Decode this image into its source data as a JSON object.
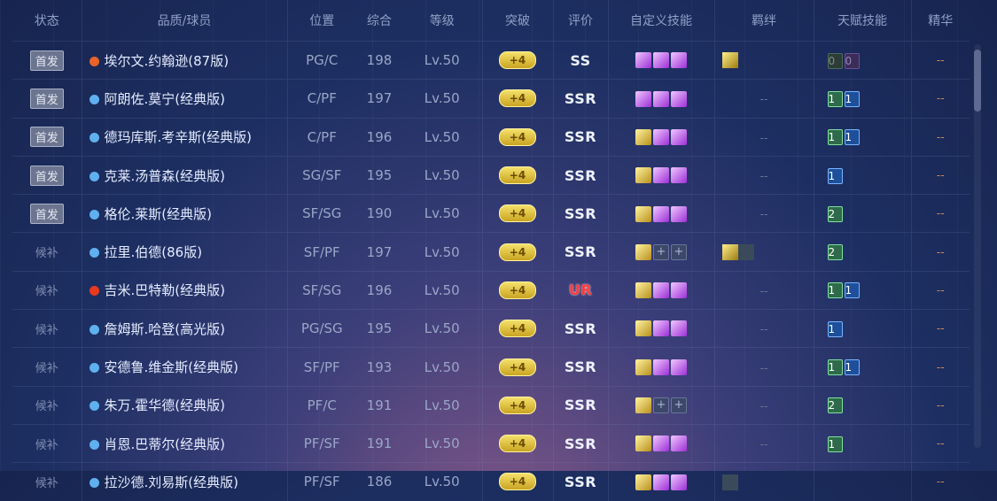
{
  "headers": {
    "status": "状态",
    "player": "品质/球员",
    "position": "位置",
    "overall": "综合",
    "level": "等级",
    "breakthrough": "突破",
    "rating": "评价",
    "custom_skills": "自定义技能",
    "bond": "羁绊",
    "talent": "天赋技能",
    "essence": "精华"
  },
  "rows": [
    {
      "status": "首发",
      "starter": true,
      "dot": "#e8632a",
      "name": "埃尔文.约翰逊(87版)",
      "pos": "PG/C",
      "ovr": "198",
      "lvl": "Lv.50",
      "brk": "+4",
      "rating": "SS",
      "skills": [
        "purple",
        "purple",
        "purple"
      ],
      "bond": [
        "gold"
      ],
      "talents": [
        {
          "v": "0",
          "c": "g0"
        },
        {
          "v": "0",
          "c": "p0"
        }
      ],
      "ess": "--"
    },
    {
      "status": "首发",
      "starter": true,
      "dot": "#5fb0ef",
      "name": "阿朗佐.莫宁(经典版)",
      "pos": "C/PF",
      "ovr": "197",
      "lvl": "Lv.50",
      "brk": "+4",
      "rating": "SSR",
      "skills": [
        "purple",
        "purple",
        "purple"
      ],
      "bond": [],
      "talents": [
        {
          "v": "1",
          "c": "green"
        },
        {
          "v": "1",
          "c": "blue"
        }
      ],
      "ess": "--"
    },
    {
      "status": "首发",
      "starter": true,
      "dot": "#5fb0ef",
      "name": "德玛库斯.考辛斯(经典版)",
      "pos": "C/PF",
      "ovr": "196",
      "lvl": "Lv.50",
      "brk": "+4",
      "rating": "SSR",
      "skills": [
        "gold",
        "purple",
        "purple"
      ],
      "bond": [],
      "talents": [
        {
          "v": "1",
          "c": "green"
        },
        {
          "v": "1",
          "c": "blue"
        }
      ],
      "ess": "--"
    },
    {
      "status": "首发",
      "starter": true,
      "dot": "#5fb0ef",
      "name": "克莱.汤普森(经典版)",
      "pos": "SG/SF",
      "ovr": "195",
      "lvl": "Lv.50",
      "brk": "+4",
      "rating": "SSR",
      "skills": [
        "gold",
        "purple",
        "purple"
      ],
      "bond": [],
      "talents": [
        {
          "v": "1",
          "c": "blue"
        }
      ],
      "ess": "--"
    },
    {
      "status": "首发",
      "starter": true,
      "dot": "#5fb0ef",
      "name": "格伦.莱斯(经典版)",
      "pos": "SF/SG",
      "ovr": "190",
      "lvl": "Lv.50",
      "brk": "+4",
      "rating": "SSR",
      "skills": [
        "gold",
        "purple",
        "purple"
      ],
      "bond": [],
      "talents": [
        {
          "v": "2",
          "c": "green"
        }
      ],
      "ess": "--"
    },
    {
      "status": "候补",
      "starter": false,
      "dot": "#5fb0ef",
      "name": "拉里.伯德(86版)",
      "pos": "SF/PF",
      "ovr": "197",
      "lvl": "Lv.50",
      "brk": "+4",
      "rating": "SSR",
      "skills": [
        "gold",
        "gray",
        "gray"
      ],
      "bond": [
        "gold",
        "dim"
      ],
      "talents": [
        {
          "v": "2",
          "c": "green"
        }
      ],
      "ess": "--"
    },
    {
      "status": "候补",
      "starter": false,
      "dot": "#e8391e",
      "name": "吉米.巴特勒(经典版)",
      "pos": "SF/SG",
      "ovr": "196",
      "lvl": "Lv.50",
      "brk": "+4",
      "rating": "UR",
      "skills": [
        "gold",
        "purple",
        "purple"
      ],
      "bond": [],
      "talents": [
        {
          "v": "1",
          "c": "green"
        },
        {
          "v": "1",
          "c": "blue"
        }
      ],
      "ess": "--"
    },
    {
      "status": "候补",
      "starter": false,
      "dot": "#5fb0ef",
      "name": "詹姆斯.哈登(高光版)",
      "pos": "PG/SG",
      "ovr": "195",
      "lvl": "Lv.50",
      "brk": "+4",
      "rating": "SSR",
      "skills": [
        "gold",
        "purple",
        "purple"
      ],
      "bond": [],
      "talents": [
        {
          "v": "1",
          "c": "blue"
        }
      ],
      "ess": "--"
    },
    {
      "status": "候补",
      "starter": false,
      "dot": "#5fb0ef",
      "name": "安德鲁.维金斯(经典版)",
      "pos": "SF/PF",
      "ovr": "193",
      "lvl": "Lv.50",
      "brk": "+4",
      "rating": "SSR",
      "skills": [
        "gold",
        "purple",
        "purple"
      ],
      "bond": [],
      "talents": [
        {
          "v": "1",
          "c": "green"
        },
        {
          "v": "1",
          "c": "blue"
        }
      ],
      "ess": "--"
    },
    {
      "status": "候补",
      "starter": false,
      "dot": "#5fb0ef",
      "name": "朱万.霍华德(经典版)",
      "pos": "PF/C",
      "ovr": "191",
      "lvl": "Lv.50",
      "brk": "+4",
      "rating": "SSR",
      "skills": [
        "gold",
        "gray",
        "gray"
      ],
      "bond": [],
      "talents": [
        {
          "v": "2",
          "c": "green"
        }
      ],
      "ess": "--"
    },
    {
      "status": "候补",
      "starter": false,
      "dot": "#5fb0ef",
      "name": "肖恩.巴蒂尔(经典版)",
      "pos": "PF/SF",
      "ovr": "191",
      "lvl": "Lv.50",
      "brk": "+4",
      "rating": "SSR",
      "skills": [
        "gold",
        "purple",
        "purple"
      ],
      "bond": [],
      "talents": [
        {
          "v": "1",
          "c": "green"
        }
      ],
      "ess": "--"
    },
    {
      "status": "候补",
      "starter": false,
      "dot": "#5fb0ef",
      "name": "拉沙德.刘易斯(经典版)",
      "pos": "PF/SF",
      "ovr": "186",
      "lvl": "Lv.50",
      "brk": "+4",
      "rating": "SSR",
      "skills": [
        "gold",
        "purple",
        "purple"
      ],
      "bond": [
        "dim"
      ],
      "talents": [],
      "ess": "--"
    }
  ],
  "empty_bond": "--"
}
